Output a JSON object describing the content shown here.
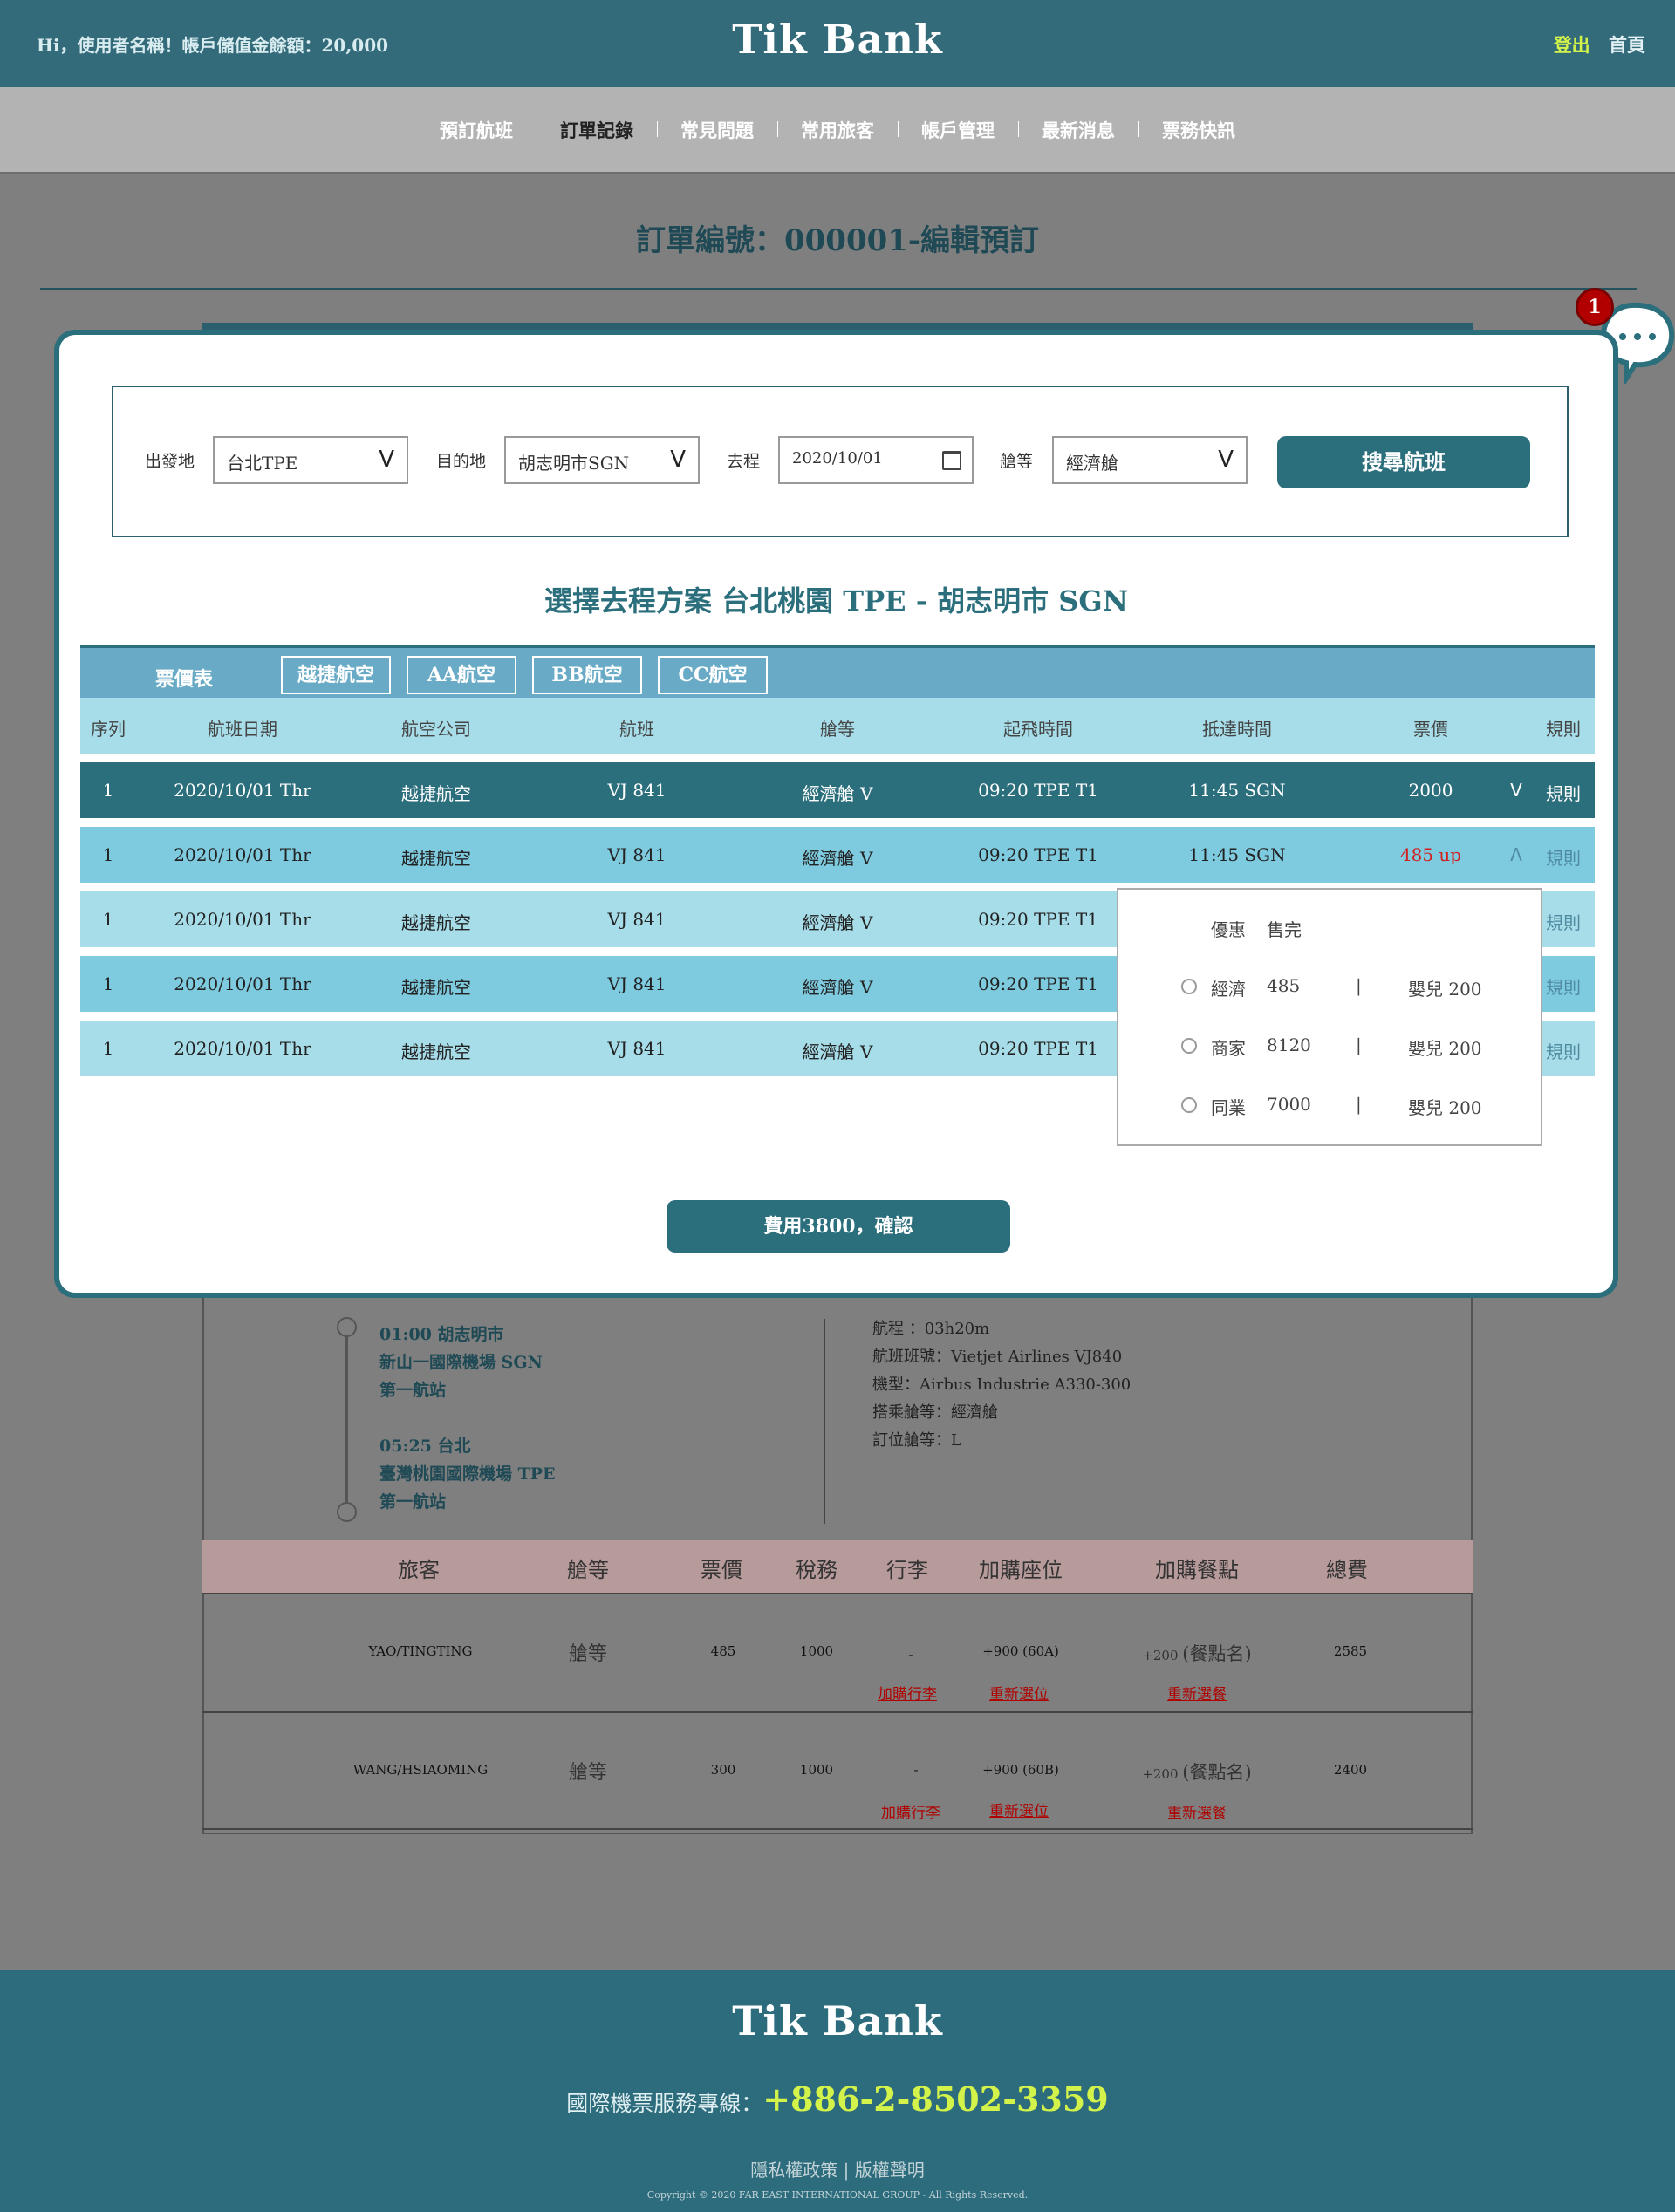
{
  "header": {
    "greeting": "Hi，使用者名稱！帳戶儲值金餘額：20,000",
    "logo": "Tik Bank",
    "logout": "登出",
    "home": "首頁"
  },
  "nav": {
    "items": [
      "預訂航班",
      "訂單記錄",
      "常見問題",
      "常用旅客",
      "帳戶管理",
      "最新消息",
      "票務快訊"
    ],
    "active": "訂單記錄"
  },
  "page_title": "訂單編號：000001-編輯預訂",
  "chat": {
    "badge": "1"
  },
  "modal": {
    "search": {
      "origin_label": "出發地",
      "origin_value": "台北TPE",
      "dest_label": "目的地",
      "dest_value": "胡志明市SGN",
      "date_label": "去程",
      "date_value": "2020/10/01",
      "class_label": "艙等",
      "class_value": "經濟艙",
      "chevron": "V",
      "search_button": "搜尋航班"
    },
    "select_title": "選擇去程方案 台北桃園 TPE - 胡志明市 SGN",
    "airline_bar": {
      "title": "票價表",
      "airlines": [
        "越捷航空",
        "AA航空",
        "BB航空",
        "CC航空"
      ]
    },
    "columns": [
      "序列",
      "航班日期",
      "航空公司",
      "航班",
      "艙等",
      "起飛時間",
      "抵達時間",
      "票價",
      "規則"
    ],
    "rows": [
      {
        "seq": "1",
        "date": "2020/10/01  Thr",
        "airline": "越捷航空",
        "flight": "VJ 841",
        "cabin": "經濟艙 V",
        "depart": "09:20 TPE T1",
        "arrive": "11:45 SGN",
        "price": "2000",
        "toggle": "V",
        "rule": "規則"
      },
      {
        "seq": "1",
        "date": "2020/10/01  Thr",
        "airline": "越捷航空",
        "flight": "VJ 841",
        "cabin": "經濟艙 V",
        "depart": "09:20 TPE T1",
        "arrive": "11:45 SGN",
        "price": "485 up",
        "toggle": "Λ",
        "rule": "規則"
      },
      {
        "seq": "1",
        "date": "2020/10/01  Thr",
        "airline": "越捷航空",
        "flight": "VJ 841",
        "cabin": "經濟艙 V",
        "depart": "09:20 TPE T1",
        "rule": "規則"
      },
      {
        "seq": "1",
        "date": "2020/10/01  Thr",
        "airline": "越捷航空",
        "flight": "VJ 841",
        "cabin": "經濟艙 V",
        "depart": "09:20 TPE T1",
        "rule": "規則"
      },
      {
        "seq": "1",
        "date": "2020/10/01  Thr",
        "airline": "越捷航空",
        "flight": "VJ 841",
        "cabin": "經濟艙 V",
        "depart": "09:20 TPE T1",
        "rule": "規則"
      }
    ],
    "fare_dropdown": {
      "header_a": "優惠",
      "header_b": "售完",
      "options": [
        {
          "name": "經濟",
          "price": "485",
          "sep": "|",
          "infant": "嬰兒 200"
        },
        {
          "name": "商家",
          "price": "8120",
          "sep": "|",
          "infant": "嬰兒 200"
        },
        {
          "name": "同業",
          "price": "7000",
          "sep": "|",
          "infant": "嬰兒 200"
        }
      ]
    },
    "confirm_button": "費用3800，確認"
  },
  "itinerary": {
    "stop1_time": "01:00 胡志明市",
    "stop1_airport": "新山一國際機場 SGN",
    "stop1_leg": "第一航站",
    "stop2_time": "05:25 台北",
    "stop2_airport": "臺灣桃園國際機場 TPE",
    "stop2_leg": "第一航站",
    "info": [
      "航程 ：03h20m",
      "航班班號：Vietjet Airlines VJ840",
      "機型：Airbus Industrie A330-300",
      "搭乘艙等：經濟艙",
      "訂位艙等：L"
    ]
  },
  "passenger_table": {
    "headers": [
      "旅客",
      "艙等",
      "票價",
      "稅務",
      "行李",
      "加購座位",
      "加購餐點",
      "總費"
    ],
    "rows": [
      {
        "name": "YAO/TINGTING",
        "cabin": "艙等",
        "fare": "485",
        "tax": "1000",
        "baggage": "-",
        "seat": "+900 (60A)",
        "meal_price": "+200",
        "meal": "(餐點名)",
        "total": "2585",
        "add_baggage": "加購行李",
        "reselect_seat": "重新選位",
        "reselect_meal": "重新選餐"
      },
      {
        "name": "WANG/HSIAOMING",
        "cabin": "艙等",
        "fare": "300",
        "tax": "1000",
        "baggage": "-",
        "seat": "+900 (60B)",
        "meal_price": "+200",
        "meal": "(餐點名)",
        "total": "2400",
        "add_baggage": "加購行李",
        "reselect_seat": "重新選位",
        "reselect_meal": "重新選餐"
      }
    ]
  },
  "footer": {
    "logo": "Tik Bank",
    "hotline_label": "國際機票服務專線：",
    "hotline_number": "+886-2-8502-3359",
    "privacy": "隱私權政策",
    "sep": "|",
    "copyright_link": "版權聲明",
    "copyright": "Copyright © 2020 FAR EAST INTERNATIONAL GROUP - All Rights Reserved."
  },
  "colors": {
    "primary": "#2b6e7c",
    "accent_green": "#d4f34a",
    "price_red": "#d21e1e",
    "row_dark": "#7ecbdf",
    "row_light": "#a6dde9"
  }
}
